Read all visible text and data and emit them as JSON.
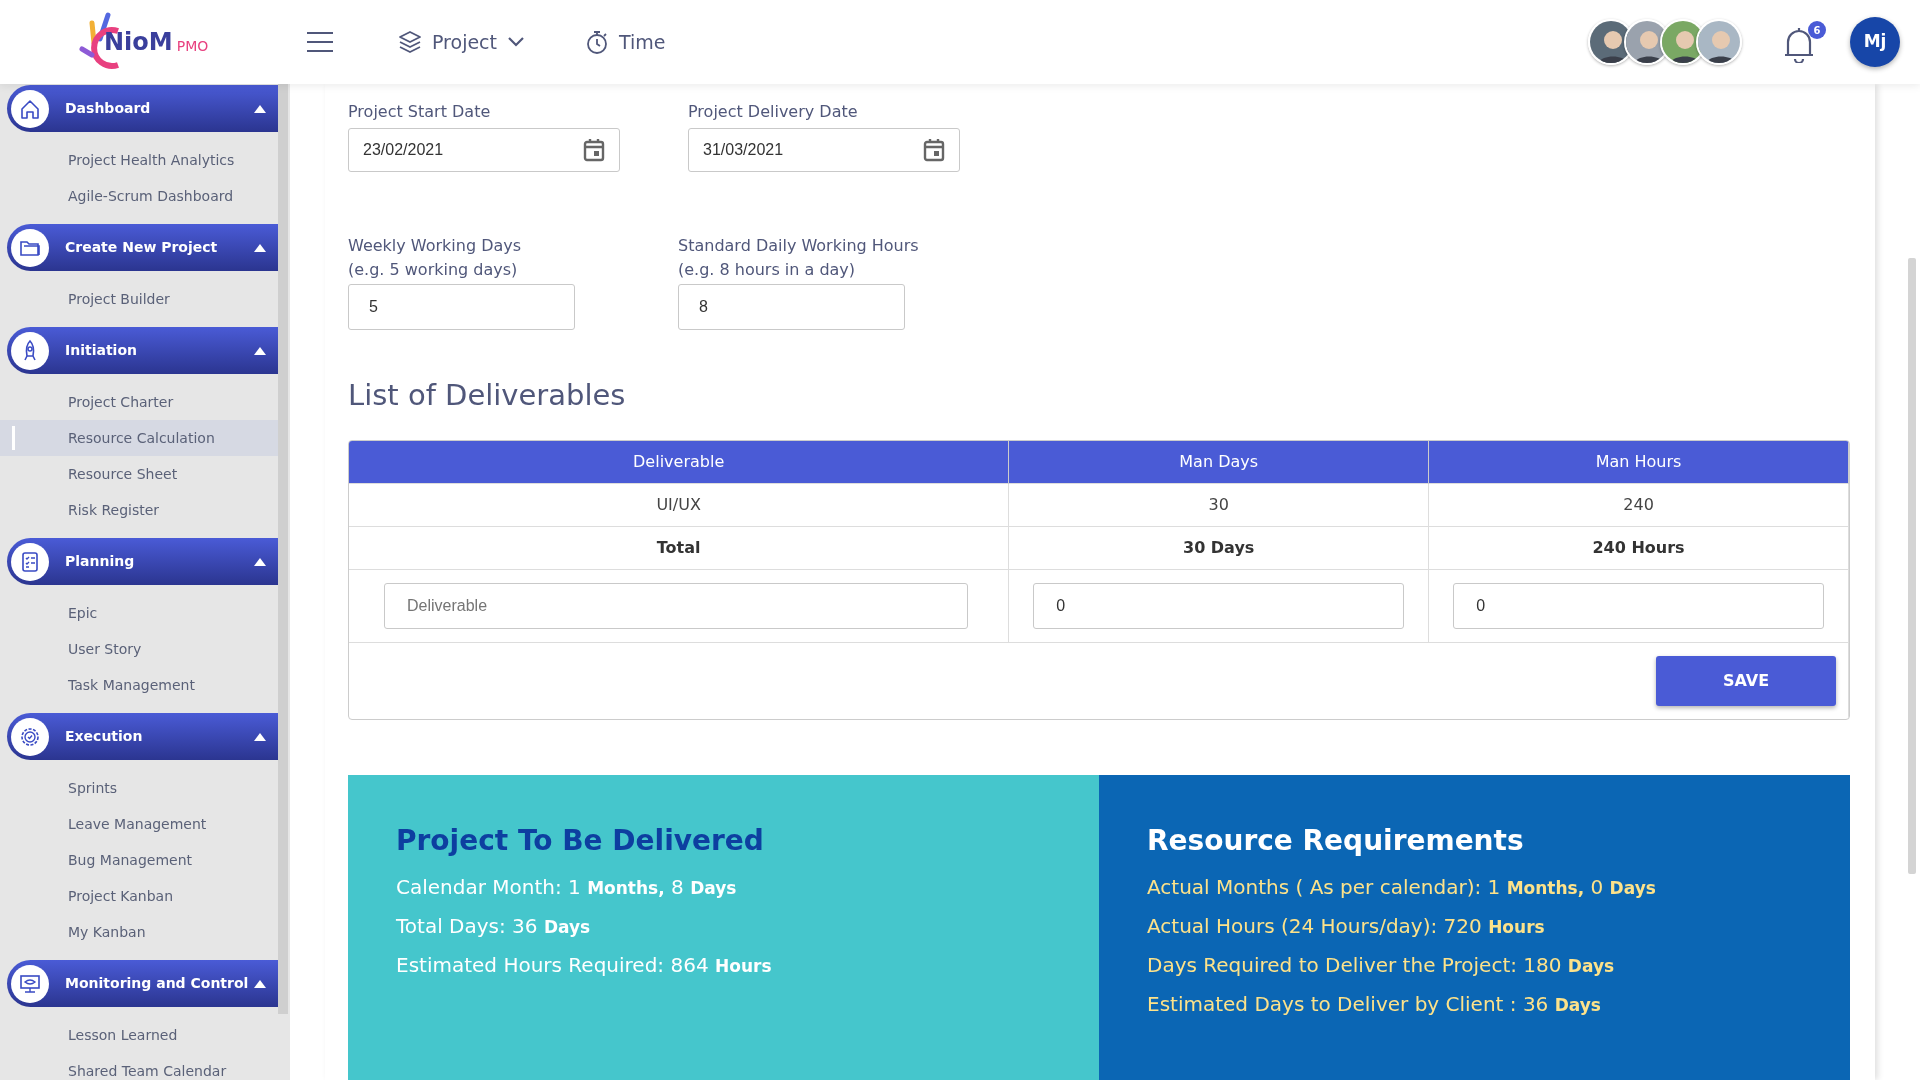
{
  "header": {
    "logo": {
      "name": "NioM",
      "suffix": "PMO"
    },
    "nav": [
      {
        "label": "Project",
        "kind": "dropdown"
      },
      {
        "label": "Time",
        "kind": "timer"
      }
    ],
    "notifications": {
      "count": "6"
    },
    "user": {
      "initials": "Mj"
    }
  },
  "sidebar": {
    "sections": [
      {
        "title": "Dashboard",
        "kind": "home",
        "expanded": true,
        "items": [
          {
            "label": "Project Health Analytics",
            "selected": false
          },
          {
            "label": "Agile-Scrum Dashboard",
            "selected": false
          }
        ]
      },
      {
        "title": "Create New Project",
        "kind": "folder",
        "expanded": true,
        "items": [
          {
            "label": "Project Builder",
            "selected": false
          }
        ]
      },
      {
        "title": "Initiation",
        "kind": "rocket",
        "expanded": true,
        "items": [
          {
            "label": "Project Charter",
            "selected": false
          },
          {
            "label": "Resource Calculation",
            "selected": true
          },
          {
            "label": "Resource Sheet",
            "selected": false
          },
          {
            "label": "Risk Register",
            "selected": false
          }
        ]
      },
      {
        "title": "Planning",
        "kind": "checklist",
        "expanded": true,
        "items": [
          {
            "label": "Epic",
            "selected": false
          },
          {
            "label": "User Story",
            "selected": false
          },
          {
            "label": "Task Management",
            "selected": false
          }
        ]
      },
      {
        "title": "Execution",
        "kind": "gear",
        "expanded": true,
        "items": [
          {
            "label": "Sprints",
            "selected": false
          },
          {
            "label": "Leave Management",
            "selected": false
          },
          {
            "label": "Bug Management",
            "selected": false
          },
          {
            "label": "Project Kanban",
            "selected": false
          },
          {
            "label": "My Kanban",
            "selected": false
          }
        ]
      },
      {
        "title": "Monitoring and Control",
        "kind": "monitor",
        "expanded": true,
        "items": [
          {
            "label": "Lesson Learned",
            "selected": false
          },
          {
            "label": "Shared Team Calendar",
            "selected": false
          }
        ]
      }
    ]
  },
  "form": {
    "dates": [
      {
        "label": "Project Start Date",
        "value": "23/02/2021"
      },
      {
        "label": "Project Delivery Date",
        "value": "31/03/2021"
      }
    ],
    "settings": [
      {
        "label": "Weekly Working Days",
        "hint": "(e.g. 5 working days)",
        "value": "5"
      },
      {
        "label": "Standard Daily Working Hours",
        "hint": "(e.g. 8 hours in a day)",
        "value": "8"
      }
    ]
  },
  "deliverables": {
    "title": "List of Deliverables",
    "columns": [
      "Deliverable",
      "Man Days",
      "Man Hours"
    ],
    "rows": [
      [
        "UI/UX",
        "30",
        "240"
      ]
    ],
    "total": [
      "Total",
      "30 Days",
      "240 Hours"
    ],
    "new_row": {
      "placeholder": "Deliverable",
      "man_days": "0",
      "man_hours": "0"
    },
    "save_button": "SAVE"
  },
  "summary": [
    {
      "title": "Project To Be Delivered",
      "kind": "teal",
      "lines": [
        "Calendar Month: 1 **Months,** 8 **Days**",
        "Total Days: 36 **Days**",
        "Estimated Hours Required: 864 **Hours**"
      ]
    },
    {
      "title": "Resource Requirements",
      "kind": "blue",
      "lines": [
        "Actual Months ( As per calendar): 1 **Months,** 0 **Days**",
        "Actual Hours (24 Hours/day): 720 **Hours**",
        "Days Required to Deliver the Project: 180 **Days**",
        "Estimated Days to Deliver by Client : 36 **Days**"
      ]
    }
  ]
}
